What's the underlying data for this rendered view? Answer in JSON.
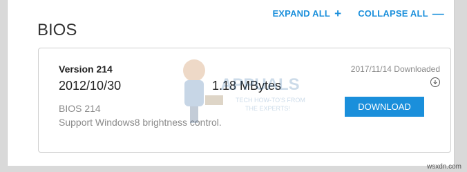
{
  "header": {
    "expand_all": "EXPAND ALL",
    "expand_symbol": "+",
    "collapse_all": "COLLAPSE ALL",
    "collapse_symbol": "—"
  },
  "section": {
    "title": "BIOS"
  },
  "item": {
    "version": "Version 214",
    "date": "2012/10/30",
    "size": "1.18 MBytes",
    "name": "BIOS 214",
    "description": "Support Windows8 brightness control.",
    "status": "2017/11/14 Downloaded",
    "download_label": "DOWNLOAD"
  },
  "watermark": {
    "brand": "APPUALS",
    "tagline_1": "TECH HOW-TO'S FROM",
    "tagline_2": "THE EXPERTS!"
  },
  "footer": {
    "credit": "wsxdn.com"
  },
  "colors": {
    "accent": "#1a8fdb",
    "text": "#222222",
    "muted": "#8a8a8a",
    "background": "#d9d9d9"
  }
}
